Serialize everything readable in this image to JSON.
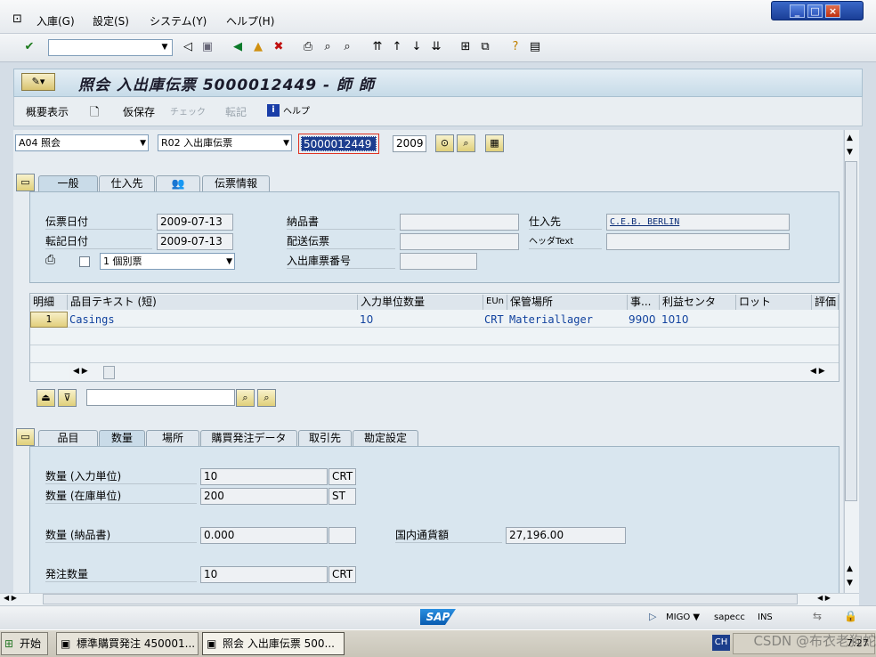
{
  "menu": {
    "items": [
      "入庫(G)",
      "設定(S)",
      "システム(Y)",
      "ヘルプ(H)"
    ]
  },
  "window": {
    "controls": [
      "_",
      "□",
      "×"
    ]
  },
  "title": "照会 入出庫伝票 5000012449 - 師 師",
  "appbar": {
    "overview": "概要表示",
    "hold": "仮保存",
    "check": "チェック",
    "post": "転記",
    "help": "ヘルプ"
  },
  "header": {
    "action": "A04 照会",
    "ref_doc": "R02 入出庫伝票",
    "doc_no": "5000012449",
    "year": "2009"
  },
  "header_tabs": [
    "一般",
    "仕入先",
    "",
    "伝票情報"
  ],
  "general": {
    "doc_date_label": "伝票日付",
    "doc_date": "2009-07-13",
    "post_date_label": "転記日付",
    "post_date": "2009-07-13",
    "delivery_note_label": "納品書",
    "delivery_note": "",
    "bill_label": "配送伝票",
    "bill": "",
    "slip_label": "入出庫票番号",
    "slip": "",
    "vendor_label": "仕入先",
    "vendor": "C.E.B. BERLIN",
    "header_text_label": "ヘッダText",
    "header_text": "",
    "print_option": "1 個別票"
  },
  "items_table": {
    "columns": [
      "明細",
      "品目テキスト (短)",
      "入力単位数量",
      "EUn",
      "保管場所",
      "事...",
      "利益センタ",
      "ロット",
      "評価"
    ],
    "rows": [
      {
        "line": "1",
        "text": "Casings",
        "qty": "10",
        "unit": "CRT",
        "sloc": "Materiallager",
        "plant": "9900",
        "profit": "1010",
        "batch": "",
        "val": ""
      }
    ]
  },
  "detail_tabs": [
    "品目",
    "数量",
    "場所",
    "購買発注データ",
    "取引先",
    "勘定設定"
  ],
  "quantity": {
    "entry_label": "数量 (入力単位)",
    "entry_qty": "10",
    "entry_unit": "CRT",
    "stock_label": "数量 (在庫単位)",
    "stock_qty": "200",
    "stock_unit": "ST",
    "dn_label": "数量 (納品書)",
    "dn_qty": "0.000",
    "dn_unit": "",
    "lc_label": "国内通貨額",
    "lc_amount": "27,196.00",
    "po_label": "発注数量",
    "po_qty": "10",
    "po_unit": "CRT"
  },
  "status": {
    "tcode": "MIGO",
    "system": "sapecc",
    "mode": "INS",
    "brand": "SAP"
  },
  "taskbar": {
    "start": "开始",
    "task1": "標準購買発注 450001...",
    "task2": "照会 入出庫伝票 500...",
    "tray_lang": "CH",
    "clock": "7:27",
    "watermark": "CSDN @布衣老狗蛇"
  }
}
